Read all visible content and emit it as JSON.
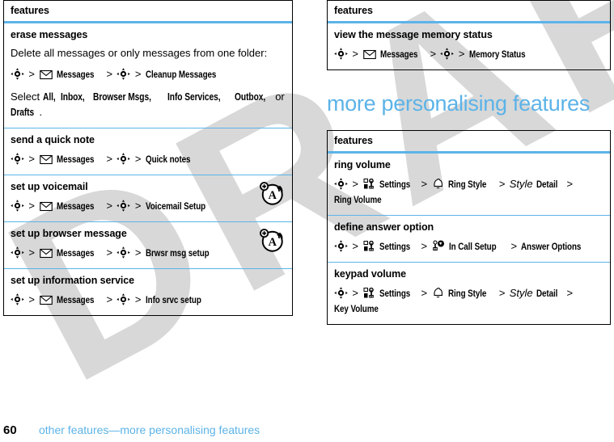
{
  "colors": {
    "accent": "#5cb3e8",
    "text": "#000000",
    "watermark": "#d8d8d8",
    "rule": "#000000"
  },
  "watermark": {
    "text": "DRAFT"
  },
  "left_column": {
    "table": {
      "header": "features",
      "rows": [
        {
          "title": "erase messages",
          "body": "Delete all messages or only messages from one folder:",
          "path": [
            {
              "type": "icon",
              "icon": "joystick-icon"
            },
            {
              "type": "sep",
              "text": ">"
            },
            {
              "type": "icon",
              "icon": "envelope-icon"
            },
            {
              "type": "kw",
              "text": "Messages"
            },
            {
              "type": "sep",
              "text": ">"
            },
            {
              "type": "icon",
              "icon": "joystick-icon"
            },
            {
              "type": "sep",
              "text": ">"
            },
            {
              "type": "kw",
              "text": "Cleanup Messages"
            }
          ],
          "note_prefix": "Select ",
          "note_options": [
            "All,",
            "Inbox,",
            "Browser Msgs,",
            "Info Services,",
            "Outbox,"
          ],
          "note_middle": " or ",
          "note_last": "Drafts",
          "note_suffix": ".",
          "badge": null
        },
        {
          "title": "send a quick note",
          "body": "",
          "path": [
            {
              "type": "icon",
              "icon": "joystick-icon"
            },
            {
              "type": "sep",
              "text": ">"
            },
            {
              "type": "icon",
              "icon": "envelope-icon"
            },
            {
              "type": "kw",
              "text": "Messages"
            },
            {
              "type": "sep",
              "text": ">"
            },
            {
              "type": "icon",
              "icon": "joystick-icon"
            },
            {
              "type": "sep",
              "text": ">"
            },
            {
              "type": "kw",
              "text": "Quick notes"
            }
          ],
          "badge": null
        },
        {
          "title": "set up voicemail",
          "body": "",
          "path": [
            {
              "type": "icon",
              "icon": "joystick-icon"
            },
            {
              "type": "sep",
              "text": ">"
            },
            {
              "type": "icon",
              "icon": "envelope-icon"
            },
            {
              "type": "kw",
              "text": "Messages"
            },
            {
              "type": "sep",
              "text": ">"
            },
            {
              "type": "icon",
              "icon": "joystick-icon"
            },
            {
              "type": "sep",
              "text": ">"
            },
            {
              "type": "kw",
              "text": "Voicemail Setup"
            }
          ],
          "badge": "network-service-icon"
        },
        {
          "title": "set up browser message",
          "body": "",
          "path": [
            {
              "type": "icon",
              "icon": "joystick-icon"
            },
            {
              "type": "sep",
              "text": ">"
            },
            {
              "type": "icon",
              "icon": "envelope-icon"
            },
            {
              "type": "kw",
              "text": "Messages"
            },
            {
              "type": "sep",
              "text": ">"
            },
            {
              "type": "icon",
              "icon": "joystick-icon"
            },
            {
              "type": "sep",
              "text": ">"
            },
            {
              "type": "kw",
              "text": "Brwsr msg setup"
            }
          ],
          "badge": "network-service-icon"
        },
        {
          "title": "set up information service",
          "body": "",
          "path": [
            {
              "type": "icon",
              "icon": "joystick-icon"
            },
            {
              "type": "sep",
              "text": ">"
            },
            {
              "type": "icon",
              "icon": "envelope-icon"
            },
            {
              "type": "kw",
              "text": "Messages"
            },
            {
              "type": "sep",
              "text": ">"
            },
            {
              "type": "icon",
              "icon": "joystick-icon"
            },
            {
              "type": "sep",
              "text": ">"
            },
            {
              "type": "kw",
              "text": "Info srvc setup"
            }
          ],
          "badge": null
        }
      ]
    }
  },
  "right_column": {
    "table_top": {
      "header": "features",
      "rows": [
        {
          "title": "view the message memory status",
          "path": [
            {
              "type": "icon",
              "icon": "joystick-icon"
            },
            {
              "type": "sep",
              "text": ">"
            },
            {
              "type": "icon",
              "icon": "envelope-icon"
            },
            {
              "type": "kw",
              "text": "Messages"
            },
            {
              "type": "sep",
              "text": ">"
            },
            {
              "type": "icon",
              "icon": "joystick-icon"
            },
            {
              "type": "sep",
              "text": ">"
            },
            {
              "type": "kw",
              "text": "Memory Status"
            }
          ]
        }
      ]
    },
    "section_heading": "more personalising features",
    "table_bottom": {
      "header": "features",
      "rows": [
        {
          "title": "ring volume",
          "path": [
            {
              "type": "icon",
              "icon": "joystick-icon"
            },
            {
              "type": "sep",
              "text": ">"
            },
            {
              "type": "icon",
              "icon": "gear-icon"
            },
            {
              "type": "kw",
              "text": "Settings"
            },
            {
              "type": "sep",
              "text": ">"
            },
            {
              "type": "icon",
              "icon": "bell-icon"
            },
            {
              "type": "kw",
              "text": "Ring Style"
            },
            {
              "type": "sep",
              "text": ">"
            },
            {
              "type": "italic",
              "text": "Style"
            },
            {
              "type": "kw",
              "text": "Detail"
            },
            {
              "type": "sep",
              "text": ">"
            },
            {
              "type": "kw",
              "text": "Ring Volume"
            }
          ]
        },
        {
          "title": "define answer option",
          "path": [
            {
              "type": "icon",
              "icon": "joystick-icon"
            },
            {
              "type": "sep",
              "text": ">"
            },
            {
              "type": "icon",
              "icon": "gear-icon"
            },
            {
              "type": "kw",
              "text": "Settings"
            },
            {
              "type": "sep",
              "text": ">"
            },
            {
              "type": "icon",
              "icon": "in-call-setup-icon"
            },
            {
              "type": "kw",
              "text": "In Call Setup"
            },
            {
              "type": "sep",
              "text": ">"
            },
            {
              "type": "kw",
              "text": "Answer Options"
            }
          ]
        },
        {
          "title": "keypad volume",
          "path": [
            {
              "type": "icon",
              "icon": "joystick-icon"
            },
            {
              "type": "sep",
              "text": ">"
            },
            {
              "type": "icon",
              "icon": "gear-icon"
            },
            {
              "type": "kw",
              "text": "Settings"
            },
            {
              "type": "sep",
              "text": ">"
            },
            {
              "type": "icon",
              "icon": "bell-icon"
            },
            {
              "type": "kw",
              "text": "Ring Style"
            },
            {
              "type": "sep",
              "text": ">"
            },
            {
              "type": "italic",
              "text": "Style"
            },
            {
              "type": "kw",
              "text": "Detail"
            },
            {
              "type": "sep",
              "text": ">"
            },
            {
              "type": "kw",
              "text": "Key Volume"
            }
          ]
        }
      ]
    }
  },
  "footer": {
    "page_number": "60",
    "breadcrumb": "other features—more personalising features"
  }
}
